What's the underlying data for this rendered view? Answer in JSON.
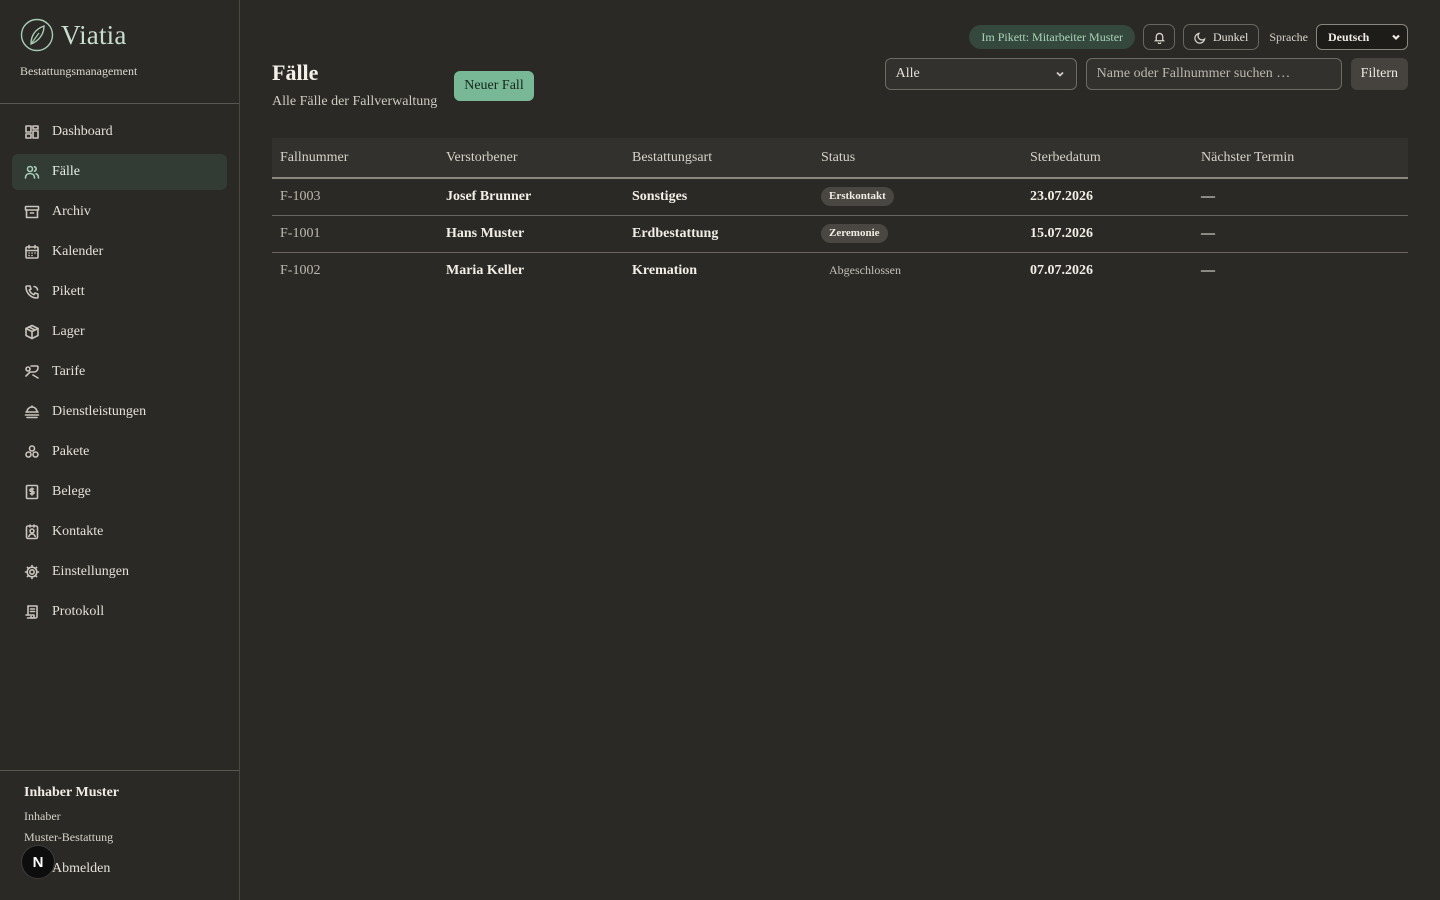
{
  "brand": {
    "name": "Viatia",
    "subtitle": "Bestattungsmanagement"
  },
  "sidebar": {
    "items": [
      {
        "label": "Dashboard",
        "icon": "dashboard-icon",
        "active": false
      },
      {
        "label": "Fälle",
        "icon": "users-icon",
        "active": true
      },
      {
        "label": "Archiv",
        "icon": "archive-icon",
        "active": false
      },
      {
        "label": "Kalender",
        "icon": "calendar-icon",
        "active": false
      },
      {
        "label": "Pikett",
        "icon": "phone-icon",
        "active": false
      },
      {
        "label": "Lager",
        "icon": "package-icon",
        "active": false
      },
      {
        "label": "Tarife",
        "icon": "tag-icon",
        "active": false
      },
      {
        "label": "Dienstleistungen",
        "icon": "service-icon",
        "active": false
      },
      {
        "label": "Pakete",
        "icon": "bundle-icon",
        "active": false
      },
      {
        "label": "Belege",
        "icon": "receipt-icon",
        "active": false
      },
      {
        "label": "Kontakte",
        "icon": "contact-icon",
        "active": false
      },
      {
        "label": "Einstellungen",
        "icon": "gear-icon",
        "active": false
      },
      {
        "label": "Protokoll",
        "icon": "log-icon",
        "active": false
      }
    ]
  },
  "user": {
    "name": "Inhaber Muster",
    "role": "Inhaber",
    "org": "Muster-Bestattung",
    "logout": "Abmelden",
    "badge": "N"
  },
  "topbar": {
    "pikett": "Im Pikett: Mitarbeiter Muster",
    "theme_label": "Dunkel",
    "language_label": "Sprache",
    "language_value": "Deutsch"
  },
  "page": {
    "title": "Fälle",
    "subtitle": "Alle Fälle der Fallverwaltung",
    "new_button": "Neuer Fall"
  },
  "filters": {
    "status_value": "Alle",
    "search_placeholder": "Name oder Fallnummer suchen …",
    "filter_button": "Filtern"
  },
  "table": {
    "columns": [
      "Fallnummer",
      "Verstorbener",
      "Bestattungsart",
      "Status",
      "Sterbedatum",
      "Nächster Termin"
    ],
    "rows": [
      {
        "case_no": "F-1003",
        "deceased": "Josef Brunner",
        "type": "Sonstiges",
        "status": "Erstkontakt",
        "status_style": "badge",
        "death_date": "23.07.2026",
        "next": "—"
      },
      {
        "case_no": "F-1001",
        "deceased": "Hans Muster",
        "type": "Erdbestattung",
        "status": "Zeremonie",
        "status_style": "badge",
        "death_date": "15.07.2026",
        "next": "—"
      },
      {
        "case_no": "F-1002",
        "deceased": "Maria Keller",
        "type": "Kremation",
        "status": "Abgeschlossen",
        "status_style": "plain",
        "death_date": "07.07.2026",
        "next": "—"
      }
    ]
  },
  "colors": {
    "accent": "#79b896",
    "background": "#2b2925",
    "active_nav": "#323b34"
  }
}
